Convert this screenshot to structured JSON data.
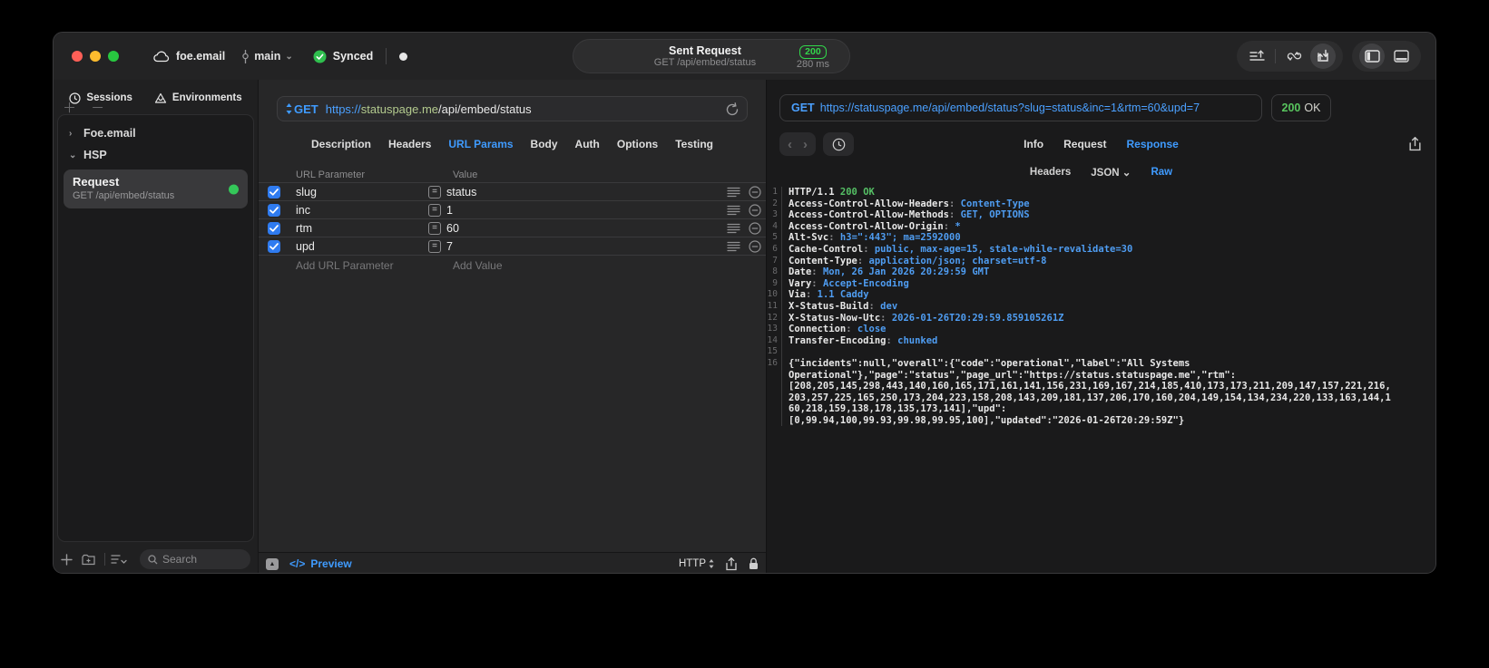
{
  "colors": {
    "accent_blue": "#3f9bff",
    "green": "#32d74b",
    "code_value_blue": "#4f9df2",
    "host_green": "#b3ca8e"
  },
  "icons": {
    "chevron_down": "⌄",
    "chevron_right": "›",
    "back": "‹",
    "forward": "›",
    "plus": "＋",
    "minus": "－",
    "equals": "=",
    "triangle_up": "▲",
    "code_tag": "</>"
  },
  "titlebar": {
    "project": "foe.email",
    "branch": "main",
    "sync_status": "Synced",
    "center": {
      "title": "Sent Request",
      "subtitle": "GET /api/embed/status",
      "status_code": "200",
      "duration": "280 ms"
    }
  },
  "sidebar": {
    "tabs": [
      {
        "label": "Sessions"
      },
      {
        "label": "Environments"
      }
    ],
    "tree": [
      {
        "label": "Foe.email"
      },
      {
        "label": "HSP"
      }
    ],
    "selected_request": {
      "name": "Request",
      "subtitle": "GET /api/embed/status"
    },
    "search_placeholder": "Search"
  },
  "request_panel": {
    "method": "GET",
    "url_scheme": "https://",
    "url_host": "statuspage.me",
    "url_path": "/api/embed/status",
    "tabs": [
      "Description",
      "Headers",
      "URL Params",
      "Body",
      "Auth",
      "Options",
      "Testing"
    ],
    "active_tab": "URL Params",
    "params_table": {
      "columns": [
        "URL Parameter",
        "Value"
      ],
      "rows": [
        {
          "enabled": true,
          "name": "slug",
          "value": "status"
        },
        {
          "enabled": true,
          "name": "inc",
          "value": "1"
        },
        {
          "enabled": true,
          "name": "rtm",
          "value": "60"
        },
        {
          "enabled": true,
          "name": "upd",
          "value": "7"
        }
      ],
      "add_name_placeholder": "Add URL Parameter",
      "add_value_placeholder": "Add Value"
    },
    "footer": {
      "preview_label": "Preview",
      "protocol": "HTTP"
    }
  },
  "response_panel": {
    "request_line": {
      "method": "GET",
      "url": "https://statuspage.me/api/embed/status?slug=status&inc=1&rtm=60&upd=7"
    },
    "status": {
      "code": "200",
      "text": "OK"
    },
    "tabs": [
      "Info",
      "Request",
      "Response"
    ],
    "active_tab": "Response",
    "subtabs": [
      {
        "label": "Headers"
      },
      {
        "label": "JSON",
        "dropdown": true
      },
      {
        "label": "Raw"
      }
    ],
    "active_subtab": "Raw",
    "code_lines": [
      {
        "n": "1",
        "seg": [
          {
            "t": "HTTP/1.1 ",
            "c": "w"
          },
          {
            "t": "200 OK",
            "c": "g"
          }
        ]
      },
      {
        "n": "2",
        "seg": [
          {
            "t": "Access-Control-Allow-Headers",
            "c": "w"
          },
          {
            "t": ": ",
            "c": "d"
          },
          {
            "t": "Content-Type",
            "c": "b"
          }
        ]
      },
      {
        "n": "3",
        "seg": [
          {
            "t": "Access-Control-Allow-Methods",
            "c": "w"
          },
          {
            "t": ": ",
            "c": "d"
          },
          {
            "t": "GET, OPTIONS",
            "c": "b"
          }
        ]
      },
      {
        "n": "4",
        "seg": [
          {
            "t": "Access-Control-Allow-Origin",
            "c": "w"
          },
          {
            "t": ": ",
            "c": "d"
          },
          {
            "t": "*",
            "c": "b"
          }
        ]
      },
      {
        "n": "5",
        "seg": [
          {
            "t": "Alt-Svc",
            "c": "w"
          },
          {
            "t": ": ",
            "c": "d"
          },
          {
            "t": "h3=\":443\"; ma=2592000",
            "c": "b"
          }
        ]
      },
      {
        "n": "6",
        "seg": [
          {
            "t": "Cache-Control",
            "c": "w"
          },
          {
            "t": ": ",
            "c": "d"
          },
          {
            "t": "public, max-age=15, stale-while-revalidate=30",
            "c": "b"
          }
        ]
      },
      {
        "n": "7",
        "seg": [
          {
            "t": "Content-Type",
            "c": "w"
          },
          {
            "t": ": ",
            "c": "d"
          },
          {
            "t": "application/json; charset=utf-8",
            "c": "b"
          }
        ]
      },
      {
        "n": "8",
        "seg": [
          {
            "t": "Date",
            "c": "w"
          },
          {
            "t": ": ",
            "c": "d"
          },
          {
            "t": "Mon, 26 Jan 2026 20:29:59 GMT",
            "c": "b"
          }
        ]
      },
      {
        "n": "9",
        "seg": [
          {
            "t": "Vary",
            "c": "w"
          },
          {
            "t": ": ",
            "c": "d"
          },
          {
            "t": "Accept-Encoding",
            "c": "b"
          }
        ]
      },
      {
        "n": "10",
        "seg": [
          {
            "t": "Via",
            "c": "w"
          },
          {
            "t": ": ",
            "c": "d"
          },
          {
            "t": "1.1 Caddy",
            "c": "b"
          }
        ]
      },
      {
        "n": "11",
        "seg": [
          {
            "t": "X-Status-Build",
            "c": "w"
          },
          {
            "t": ": ",
            "c": "d"
          },
          {
            "t": "dev",
            "c": "b"
          }
        ]
      },
      {
        "n": "12",
        "seg": [
          {
            "t": "X-Status-Now-Utc",
            "c": "w"
          },
          {
            "t": ": ",
            "c": "d"
          },
          {
            "t": "2026-01-26T20:29:59.859105261Z",
            "c": "b"
          }
        ]
      },
      {
        "n": "13",
        "seg": [
          {
            "t": "Connection",
            "c": "w"
          },
          {
            "t": ": ",
            "c": "d"
          },
          {
            "t": "close",
            "c": "b"
          }
        ]
      },
      {
        "n": "14",
        "seg": [
          {
            "t": "Transfer-Encoding",
            "c": "w"
          },
          {
            "t": ": ",
            "c": "d"
          },
          {
            "t": "chunked",
            "c": "b"
          }
        ]
      },
      {
        "n": "15",
        "seg": []
      },
      {
        "n": "16",
        "seg": [
          {
            "t": "{\"incidents\":null,\"overall\":{\"code\":\"operational\",\"label\":\"All Systems",
            "c": "w"
          }
        ]
      },
      {
        "n": "",
        "seg": [
          {
            "t": "Operational\"},\"page\":\"status\",\"page_url\":\"https://status.statuspage.me\",\"rtm\":",
            "c": "w"
          }
        ]
      },
      {
        "n": "",
        "seg": [
          {
            "t": "[208,205,145,298,443,140,160,165,171,161,141,156,231,169,167,214,185,410,173,173,211,209,147,157,221,216,",
            "c": "w"
          }
        ]
      },
      {
        "n": "",
        "seg": [
          {
            "t": "203,257,225,165,250,173,204,223,158,208,143,209,181,137,206,170,160,204,149,154,134,234,220,133,163,144,1",
            "c": "w"
          }
        ]
      },
      {
        "n": "",
        "seg": [
          {
            "t": "60,218,159,138,178,135,173,141],\"upd\":",
            "c": "w"
          }
        ]
      },
      {
        "n": "",
        "seg": [
          {
            "t": "[0,99.94,100,99.93,99.98,99.95,100],\"updated\":\"2026-01-26T20:29:59Z\"}",
            "c": "w"
          }
        ]
      }
    ]
  }
}
